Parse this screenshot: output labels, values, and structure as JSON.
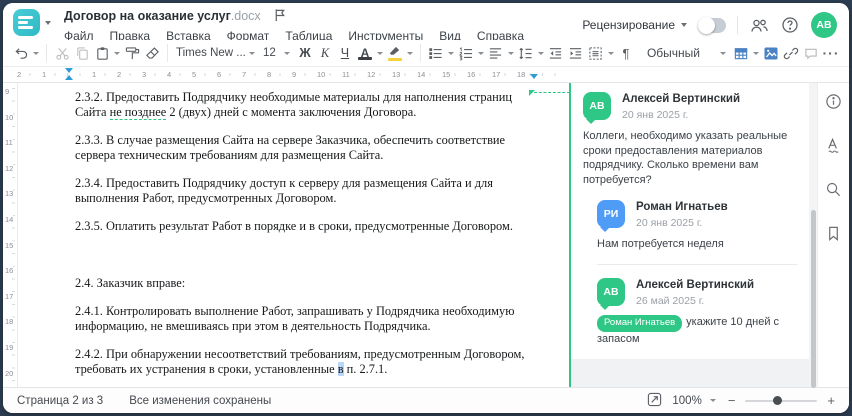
{
  "app": {
    "title": "Договор на оказание услуг",
    "title_ext": ".docx",
    "menu": [
      "Файл",
      "Правка",
      "Вставка",
      "Формат",
      "Таблица",
      "Инструменты",
      "Вид",
      "Справка"
    ],
    "review_label": "Рецензирование",
    "user_initials": "АВ"
  },
  "toolbar": {
    "font_name": "Times New ...",
    "font_size": "12",
    "bold_label": "Ж",
    "italic_label": "К",
    "underline_label": "Ч",
    "font_color_label": "А",
    "style_name": "Обычный"
  },
  "ruler": {
    "h_numbers": [
      "2",
      "1",
      "1",
      "2",
      "3",
      "4",
      "5",
      "6",
      "7",
      "8",
      "9",
      "10",
      "11",
      "12",
      "13",
      "14",
      "15",
      "16",
      "17",
      "18"
    ],
    "v_numbers": [
      "9",
      "10",
      "11",
      "12",
      "13",
      "14",
      "15",
      "16",
      "17",
      "18",
      "19",
      "20"
    ]
  },
  "document": {
    "p232_a": "2.3.2. Предоставить Подрядчику необходимые материалы для наполнения страниц Сайта ",
    "p232_anchor": "не позднее",
    "p232_b": " 2 (двух) дней с момента заключения Договора.",
    "p233": "2.3.3. В случае размещения Сайта на сервере Заказчика, обеспечить соответствие сервера техническим требованиям для размещения Сайта.",
    "p234": "2.3.4. Предоставить Подрядчику доступ к серверу для размещения Сайта и для выполнения Работ, предусмотренных Договором.",
    "p235": "2.3.5. Оплатить результат Работ в порядке и в сроки, предусмотренные Договором.",
    "p24": "2.4. Заказчик вправе:",
    "p241": "2.4.1. Контролировать выполнение Работ, запрашивать у Подрядчика необходимую информацию, не вмешиваясь при этом в деятельность Подрядчика.",
    "p242_a": "2.4.2. При обнаружении несоответствий требованиям, предусмотренным Договором, требовать их устранения в сроки, установленные ",
    "p242_hl": "в",
    "p242_b": " п. 2.7.1."
  },
  "comments": {
    "c1": {
      "initials": "АВ",
      "name": "Алексей Вертинский",
      "date": "20 янв 2025 г.",
      "text": "Коллеги, необходимо указать реальные сроки предоставления материалов подрядчику. Сколько времени вам потребуется?"
    },
    "r1": {
      "initials": "РИ",
      "name": "Роман Игнатьев",
      "date": "20 янв 2025 г.",
      "text": "Нам потребуется неделя"
    },
    "r2": {
      "initials": "АВ",
      "name": "Алексей Вертинский",
      "date": "26 май 2025 г.",
      "mention": "Роман Игнатьев",
      "text": "укажите 10 дней с запасом"
    }
  },
  "statusbar": {
    "page_info": "Страница 2 из 3",
    "saved_info": "Все изменения сохранены",
    "zoom_value": "100%"
  },
  "icons": {
    "undo-icon": "curved left arrow",
    "cut-icon": "scissors (disabled)",
    "copy-icon": "two pages (disabled)",
    "paste-icon": "clipboard",
    "format-painter-icon": "paint brush",
    "clear-style-icon": "eraser",
    "bullet-list-icon": "dotted lines",
    "numbered-list-icon": "numbered lines",
    "align-left-icon": "left aligned lines",
    "line-spacing-icon": "vertical arrows with lines",
    "outdent-icon": "lines with left arrow",
    "indent-icon": "lines with right arrow",
    "paragraph-settings-icon": "dashed box with lines",
    "pilcrow-icon": "¶",
    "table-icon": "blue grid",
    "image-icon": "blue picture",
    "link-icon": "chain",
    "comment-icon": "speech bubble",
    "more-icon": "···",
    "collaboration-icon": "two people",
    "help-icon": "? in circle",
    "info-icon": "i in circle",
    "spellcheck-icon": "A over wavy line",
    "search-icon": "magnifier",
    "bookmark-icon": "bookmark ribbon",
    "flag-icon": "flag outline",
    "fit-width-icon": "square with diagonal arrow"
  },
  "colors": {
    "brand_teal": "#3fc4ce",
    "accent_green": "#2fc785",
    "avatar_blue": "#4f9cf6",
    "marker_blue": "#2f9bd8",
    "desktop_navy": "#2d3e53"
  }
}
